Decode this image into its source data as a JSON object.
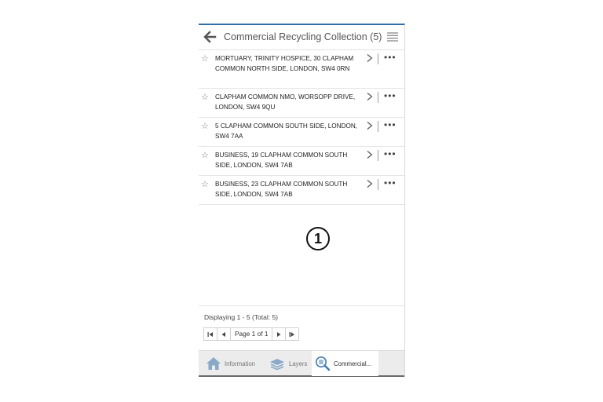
{
  "header": {
    "title": "Commercial Recycling Collection (5)",
    "back_icon": "back-arrow-icon",
    "menu_icon": "hamburger-menu-icon"
  },
  "results": [
    {
      "address": "MORTUARY, TRINITY HOSPICE, 30 CLAPHAM COMMON NORTH SIDE, LONDON, SW4 0RN"
    },
    {
      "address": "CLAPHAM COMMON NMO, WORSOPP DRIVE, LONDON, SW4 9QU"
    },
    {
      "address": "5 CLAPHAM COMMON SOUTH SIDE, LONDON, SW4 7AA"
    },
    {
      "address": "BUSINESS, 19 CLAPHAM COMMON SOUTH SIDE, LONDON, SW4 7AB"
    },
    {
      "address": "BUSINESS, 23 CLAPHAM COMMON SOUTH SIDE, LONDON, SW4 7AB"
    }
  ],
  "row_actions": {
    "star": "☆",
    "more": "•••"
  },
  "marker": "1",
  "footer": {
    "display_text": "Displaying 1 - 5 (Total: 5)",
    "page_label": "Page 1 of 1"
  },
  "tabs": [
    {
      "label": "Information",
      "icon": "home-icon"
    },
    {
      "label": "Layers",
      "icon": "layers-icon"
    },
    {
      "label": "Commercial...",
      "icon": "search-list-icon"
    }
  ],
  "colors": {
    "accent": "#2f6fa6",
    "tab_bar": "#ececec"
  }
}
